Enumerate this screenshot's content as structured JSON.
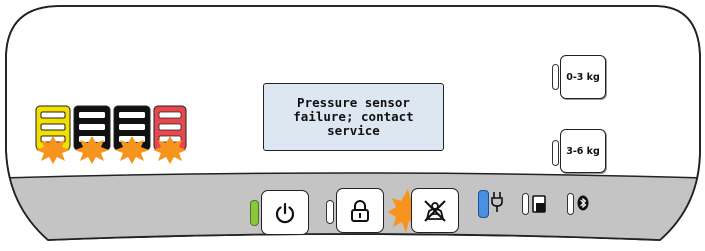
{
  "display": {
    "message": "Pressure sensor failure; contact service"
  },
  "weight_buttons": [
    {
      "label": "0-3 kg",
      "led_on": false
    },
    {
      "label": "3-6 kg",
      "led_on": false
    }
  ],
  "level_indicators": [
    {
      "color": "#f3e000",
      "alert": true
    },
    {
      "color": "#111111",
      "alert": true
    },
    {
      "color": "#111111",
      "alert": true
    },
    {
      "color": "#e8474d",
      "alert": true
    }
  ],
  "controls": {
    "power": {
      "icon": "power-icon",
      "led_color": "#8cc63f",
      "led_on": true
    },
    "lock": {
      "icon": "padlock-icon",
      "led_on": false
    },
    "weigh": {
      "icon": "weight-person-crossed-icon",
      "alert": true
    },
    "plug": {
      "icon": "plug-icon",
      "led_color": "#4a90e2",
      "led_on": true
    },
    "device": {
      "icon": "device-icon",
      "led_on": false
    },
    "bluetooth": {
      "icon": "bluetooth-icon",
      "led_on": false
    }
  },
  "colors": {
    "panel_bottom": "#c4c4c4",
    "alert_orange": "#f7941d",
    "outline": "#222222"
  }
}
